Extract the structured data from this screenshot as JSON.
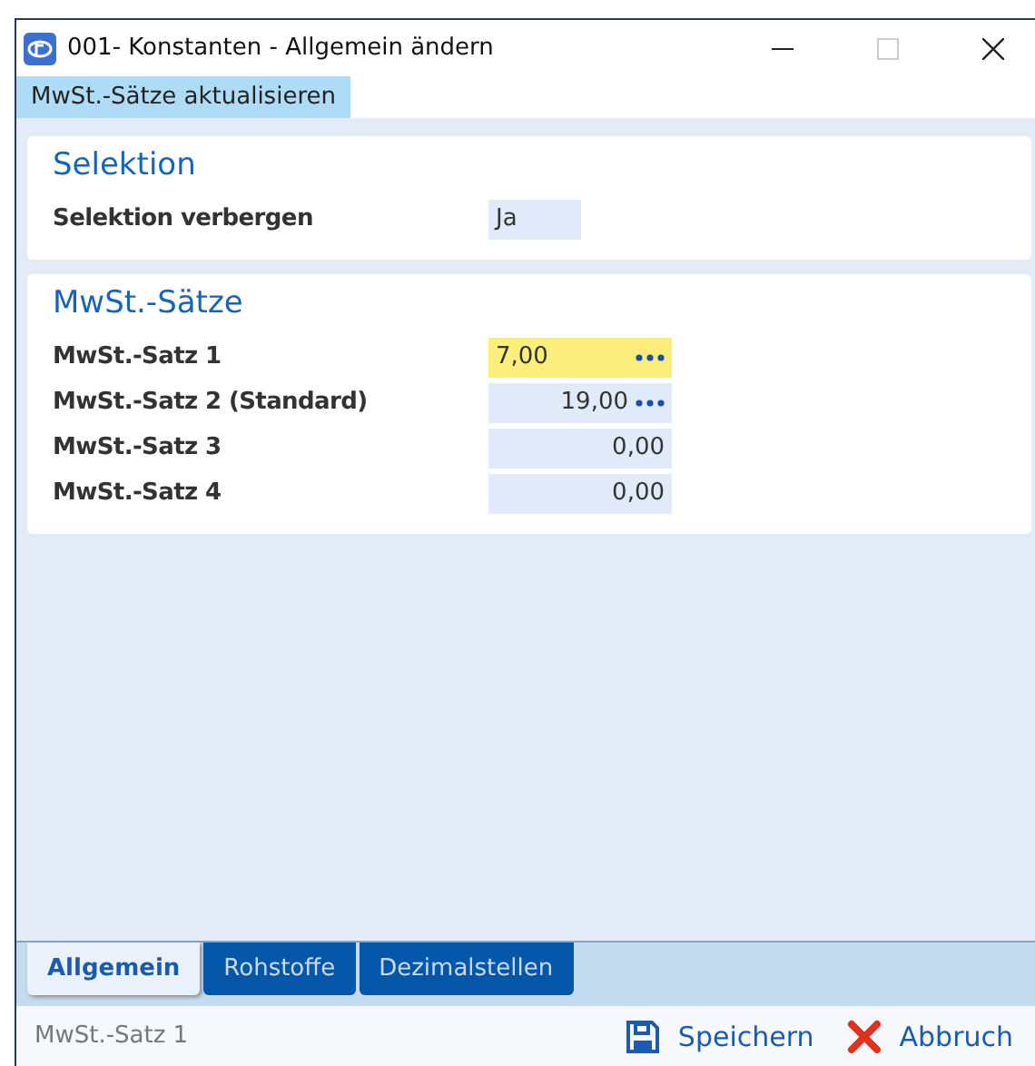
{
  "window": {
    "title": "001- Konstanten - Allgemein ändern"
  },
  "menu": [
    {
      "label": "MwSt.-Sätze aktualisieren",
      "selected": true
    }
  ],
  "sections": [
    {
      "title": "Selektion",
      "fields": [
        {
          "label": "Selektion verbergen",
          "value": "Ja",
          "kind": "short",
          "focused": false,
          "picker": false
        }
      ]
    },
    {
      "title": "MwSt.-Sätze",
      "fields": [
        {
          "label": "MwSt.-Satz 1",
          "value": "7,00",
          "kind": "number",
          "focused": true,
          "picker": true
        },
        {
          "label": "MwSt.-Satz 2 (Standard)",
          "value": "19,00",
          "kind": "number",
          "focused": false,
          "picker": true
        },
        {
          "label": "MwSt.-Satz 3",
          "value": "0,00",
          "kind": "number",
          "focused": false,
          "picker": false
        },
        {
          "label": "MwSt.-Satz 4",
          "value": "0,00",
          "kind": "number",
          "focused": false,
          "picker": false
        }
      ]
    }
  ],
  "tabs": [
    {
      "label": "Allgemein",
      "selected": true
    },
    {
      "label": "Rohstoffe",
      "selected": false
    },
    {
      "label": "Dezimalstellen",
      "selected": false
    }
  ],
  "status_bar": {
    "text": "MwSt.-Satz 1",
    "buttons": [
      {
        "label": "Speichern",
        "kind": "save"
      },
      {
        "label": "Abbruch",
        "kind": "cancel"
      }
    ]
  }
}
